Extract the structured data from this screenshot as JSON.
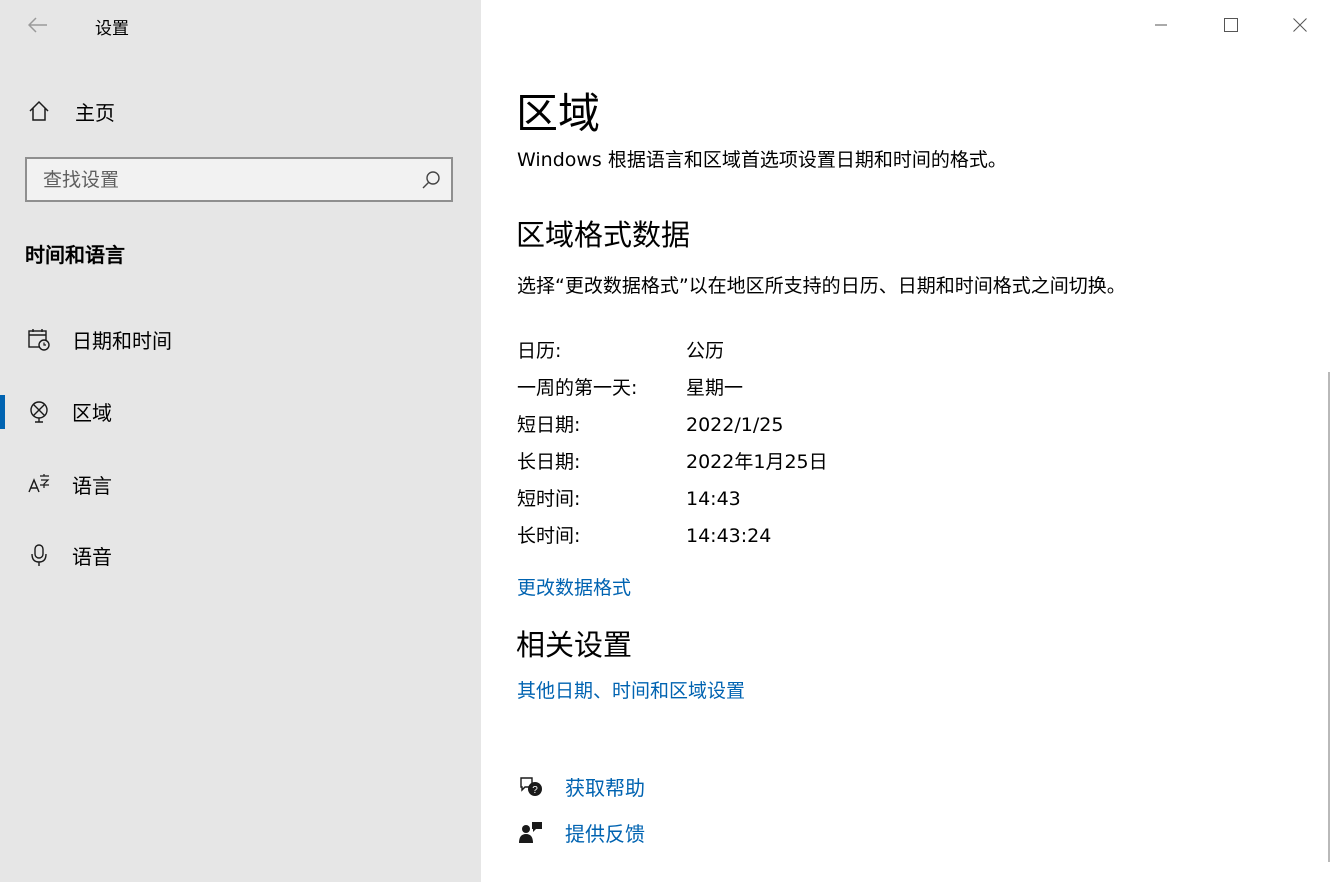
{
  "app": {
    "title": "设置",
    "back_icon": "arrow-left-icon"
  },
  "sidebar": {
    "home_label": "主页",
    "search_placeholder": "查找设置",
    "section_heading": "时间和语言",
    "items": [
      {
        "label": "日期和时间",
        "icon": "calendar-clock-icon",
        "selected": false
      },
      {
        "label": "区域",
        "icon": "globe-icon",
        "selected": true
      },
      {
        "label": "语言",
        "icon": "language-icon",
        "selected": false
      },
      {
        "label": "语音",
        "icon": "microphone-icon",
        "selected": false
      }
    ]
  },
  "window_controls": {
    "minimize_icon": "minimize-icon",
    "maximize_icon": "maximize-icon",
    "close_icon": "close-icon"
  },
  "main": {
    "title": "区域",
    "description": "Windows 根据语言和区域首选项设置日期和时间的格式。",
    "format_heading": "区域格式数据",
    "format_description": "选择“更改数据格式”以在地区所支持的日历、日期和时间格式之间切换。",
    "format_rows": [
      {
        "label": "日历:",
        "value": "公历"
      },
      {
        "label": "一周的第一天:",
        "value": "星期一"
      },
      {
        "label": "短日期:",
        "value": "2022/1/25"
      },
      {
        "label": "长日期:",
        "value": "2022年1月25日"
      },
      {
        "label": "短时间:",
        "value": "14:43"
      },
      {
        "label": "长时间:",
        "value": "14:43:24"
      }
    ],
    "change_format_link": "更改数据格式",
    "related_heading": "相关设置",
    "related_link": "其他日期、时间和区域设置",
    "help_link": "获取帮助",
    "feedback_link": "提供反馈"
  },
  "colors": {
    "accent": "#0063b1",
    "sidebar_bg": "#e6e6e6",
    "main_bg": "#ffffff"
  }
}
